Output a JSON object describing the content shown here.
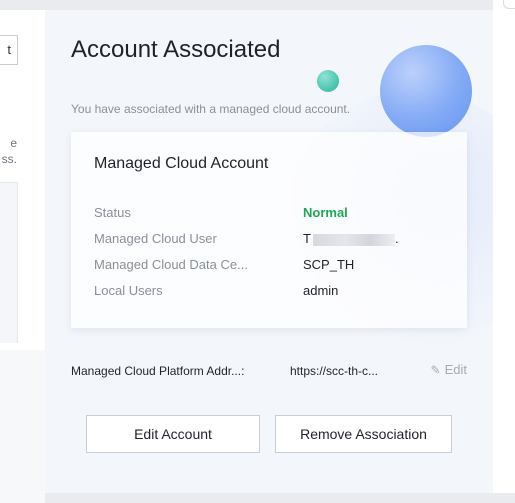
{
  "left": {
    "button_label": "t",
    "text_line1": "e",
    "text_line2": "ss."
  },
  "panel": {
    "title": "Account Associated",
    "subtitle": "You have associated with a managed cloud account."
  },
  "card": {
    "title": "Managed Cloud Account",
    "fields": [
      {
        "label": "Status",
        "value": "Normal"
      },
      {
        "label": "Managed Cloud User",
        "value": "T"
      },
      {
        "label": "Managed Cloud Data Ce...",
        "value": "SCP_TH"
      },
      {
        "label": "Local Users",
        "value": "admin"
      }
    ],
    "user_suffix": ".",
    "status_color": "#1aaa55"
  },
  "address": {
    "label": "Managed Cloud Platform Addr...:",
    "value": "https://scc-th-c...",
    "edit_label": "Edit"
  },
  "buttons": {
    "edit_account": "Edit Account",
    "remove_association": "Remove Association"
  },
  "icons": {
    "edit": "pencil-icon"
  }
}
